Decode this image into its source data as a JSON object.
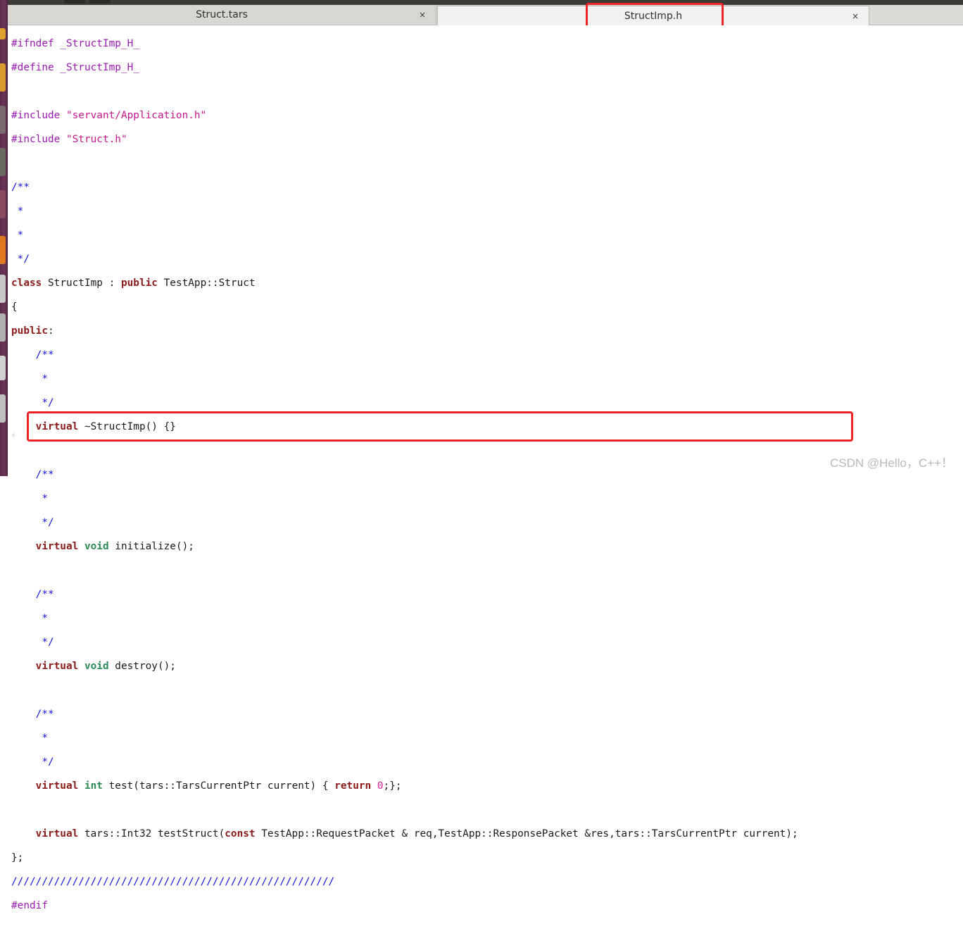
{
  "tabs": [
    {
      "label": "Struct.tars",
      "close": "×"
    },
    {
      "label": "StructImp.h",
      "close": "×"
    }
  ],
  "code": {
    "l1": {
      "a": "#ifndef _StructImp_H_"
    },
    "l2": {
      "a": "#define _StructImp_H_"
    },
    "l4": {
      "a": "#include ",
      "b": "\"servant/Application.h\""
    },
    "l5": {
      "a": "#include ",
      "b": "\"Struct.h\""
    },
    "l7": {
      "a": "/**"
    },
    "l8": {
      "a": " *"
    },
    "l9": {
      "a": " *"
    },
    "l10": {
      "a": " */"
    },
    "l11": {
      "a": "class",
      "b": " StructImp : ",
      "c": "public",
      "d": " TestApp::Struct"
    },
    "l12": {
      "a": "{"
    },
    "l13": {
      "a": "public",
      "b": ":"
    },
    "l14": {
      "a": "    /**"
    },
    "l15": {
      "a": "     *"
    },
    "l16": {
      "a": "     */"
    },
    "l17": {
      "a": "    ",
      "b": "virtual",
      "c": " ~StructImp() {}"
    },
    "l19": {
      "a": "    /**"
    },
    "l20": {
      "a": "     *"
    },
    "l21": {
      "a": "     */"
    },
    "l22": {
      "a": "    ",
      "b": "virtual",
      "c": " ",
      "d": "void",
      "e": " initialize();"
    },
    "l24": {
      "a": "    /**"
    },
    "l25": {
      "a": "     *"
    },
    "l26": {
      "a": "     */"
    },
    "l27": {
      "a": "    ",
      "b": "virtual",
      "c": " ",
      "d": "void",
      "e": " destroy();"
    },
    "l29": {
      "a": "    /**"
    },
    "l30": {
      "a": "     *"
    },
    "l31": {
      "a": "     */"
    },
    "l32": {
      "a": "    ",
      "b": "virtual",
      "c": " ",
      "d": "int",
      "e": " test(tars::TarsCurrentPtr current) { ",
      "f": "return",
      "g": " ",
      "h": "0",
      "i": ";};"
    },
    "l34": {
      "a": "    ",
      "b": "virtual",
      "c": " tars::Int32 testStruct(",
      "d": "const",
      "e": " TestApp::RequestPacket & req,TestApp::ResponsePacket &res,tars::TarsCurrentPtr current);"
    },
    "l35": {
      "a": "};"
    },
    "l36": {
      "a": "/////////////////////////////////////////////////////"
    },
    "l37": {
      "a": "#endif"
    }
  },
  "watermark": "CSDN @Hello，C++！",
  "colors": {
    "highlight": "#ec2424",
    "keyword": "#8b1a1a",
    "type": "#2e8b57",
    "comment": "#1515d6",
    "preprocessor": "#9a1bb0",
    "string": "#c4188b"
  }
}
